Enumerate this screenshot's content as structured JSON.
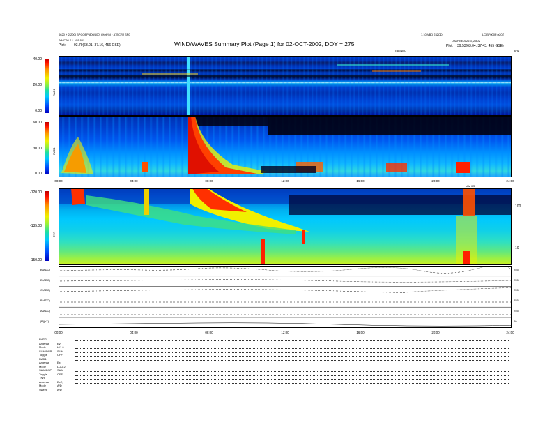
{
  "header": {
    "left_line1": "0620 + 2(200) BPCOBP(800/600) (%eb%) · ATBCRJ SP0",
    "left_line2": "ABJPB0 2 + 130 001",
    "left_plot_label": "Plot:",
    "left_coords": "93.79(63.01, 37.16, 456 GSE)",
    "title": "WIND/WAVES Summary Plot (Page 1) for 02-OCT-2002, DOY = 275",
    "center_right": "1.10 VBD 232CD",
    "right_top": "LC BF000F=r20Z",
    "right_line2": "DALY BE0126 3, 29/02",
    "right_coords": "39.53(63.04, 37.43, 455 GSE)",
    "right_plot_label": "Plot:",
    "sub_center": "TBLINBC",
    "unit_top": "kHz"
  },
  "chart_data": [
    {
      "type": "heatmap",
      "name": "RAD2",
      "ylabel": "RAD2",
      "ytick_labels": [
        "40.00",
        "20.00",
        "0.00"
      ],
      "ylim": [
        0,
        40
      ]
    },
    {
      "type": "heatmap",
      "name": "RAD1",
      "ylabel": "RAD1",
      "ytick_labels": [
        "60.00",
        "30.00",
        "0.00"
      ],
      "ylim": [
        0,
        60
      ],
      "xtick_labels": [
        "00:00",
        "04:00",
        "08:00",
        "12:00",
        "16:00",
        "20:00",
        "24:00"
      ]
    },
    {
      "type": "heatmap",
      "name": "TNR",
      "ylabel": "TNR",
      "ytick_labels": [
        "-120.00",
        "-135.00",
        "-150.00"
      ],
      "ylim": [
        -150,
        -120
      ],
      "right_tick_labels": [
        "100",
        "10"
      ],
      "right_top_label": "kHz 0G"
    },
    {
      "type": "line",
      "name": "housekeeping",
      "row_labels": [
        "B(ADC)",
        "D(ADC)",
        "C(ADC)",
        "B(ADC)",
        "A(ADC)",
        "|B|(nT)"
      ],
      "right_labels": [
        "255",
        "255",
        "255",
        "255",
        "255",
        "20"
      ],
      "xtick_labels": [
        "00:00",
        "04:00",
        "08:00",
        "12:00",
        "16:00",
        "20:00",
        "24:00"
      ]
    }
  ],
  "footer": {
    "rows": [
      {
        "label": "RAD2",
        "key": "",
        "value": ""
      },
      {
        "label": "Antenna",
        "key": "",
        "value": "Ey"
      },
      {
        "label": "Mode",
        "key": "",
        "value": "LIN 0"
      },
      {
        "label": "SUM/DSP",
        "key": "",
        "value": "SUM"
      },
      {
        "label": "Toggle",
        "key": "",
        "value": "OFF"
      },
      {
        "label": "RAD1",
        "key": "",
        "value": ""
      },
      {
        "label": "Antenna",
        "key": "",
        "value": "Ex"
      },
      {
        "label": "Mode",
        "key": "",
        "value": "LOG 2"
      },
      {
        "label": "SUM/DSP",
        "key": "",
        "value": "SUM"
      },
      {
        "label": "Toggle",
        "key": "",
        "value": "OFF"
      },
      {
        "label": "TNR",
        "key": "",
        "value": ""
      },
      {
        "label": "Antenna",
        "key": "",
        "value": "ExEy"
      },
      {
        "label": "Mode",
        "key": "",
        "value": "A/D"
      },
      {
        "label": "Sweep",
        "key": "",
        "value": "A/D"
      }
    ]
  },
  "colors": {
    "deep_blue": "#0010a0",
    "blue": "#0050ff",
    "cyan": "#00c8ff",
    "green": "#40e070",
    "yellow": "#f0f000",
    "orange": "#ff9000",
    "red": "#e01000",
    "black": "#000000"
  }
}
